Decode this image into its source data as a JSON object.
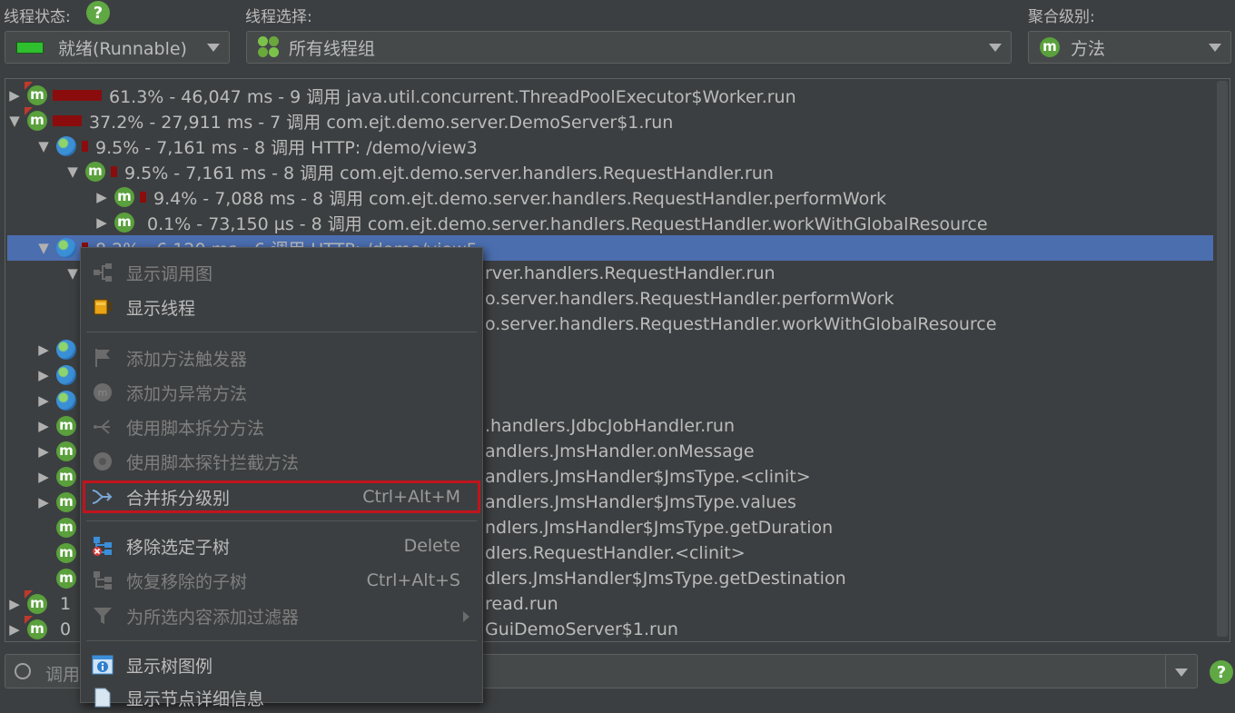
{
  "header": {
    "thread_state_label": "线程状态:",
    "thread_select_label": "线程选择:",
    "aggregation_label": "聚合级别:",
    "thread_state_value": "就绪(Runnable)",
    "thread_select_value": "所有线程组",
    "aggregation_value": "方法",
    "help_glyph": "?"
  },
  "icons": {
    "method_glyph": "m"
  },
  "tree": {
    "rows": [
      {
        "text": "61.3% - 46,047 ms - 9 调用 java.util.concurrent.ThreadPoolExecutor$Worker.run"
      },
      {
        "text": "37.2% - 27,911 ms - 7 调用 com.ejt.demo.server.DemoServer$1.run"
      },
      {
        "text": "9.5% - 7,161 ms - 8 调用 HTTP: /demo/view3"
      },
      {
        "text": "9.5% - 7,161 ms - 8 调用 com.ejt.demo.server.handlers.RequestHandler.run"
      },
      {
        "text": "9.4% - 7,088 ms - 8 调用 com.ejt.demo.server.handlers.RequestHandler.performWork"
      },
      {
        "text": "0.1% - 73,150 µs - 8 调用 com.ejt.demo.server.handlers.RequestHandler.workWithGlobalResource"
      },
      {
        "text": "8.2% - 6,120 ms - 6 调用 HTTP: /demo/view5"
      },
      {
        "text": "rver.handlers.RequestHandler.run"
      },
      {
        "text": "o.server.handlers.RequestHandler.performWork"
      },
      {
        "text": "o.server.handlers.RequestHandler.workWithGlobalResource"
      },
      {
        "text": ""
      },
      {
        "text": ""
      },
      {
        "text": ""
      },
      {
        "text": ".handlers.JdbcJobHandler.run"
      },
      {
        "text": "andlers.JmsHandler.onMessage"
      },
      {
        "text": "andlers.JmsHandler$JmsType.<clinit>"
      },
      {
        "text": "andlers.JmsHandler$JmsType.values"
      },
      {
        "text": "ndlers.JmsHandler$JmsType.getDuration"
      },
      {
        "text": "dlers.RequestHandler.<clinit>"
      },
      {
        "text": "dlers.JmsHandler$JmsType.getDestination"
      },
      {
        "text": "read.run"
      },
      {
        "text": "GuiDemoServer$1.run"
      }
    ],
    "partial_row_19_prefix": "1",
    "partial_row_20_prefix": "0"
  },
  "context_menu": {
    "items": [
      {
        "label": "显示调用图",
        "shortcut": "",
        "icon": "call-graph-icon",
        "enabled": false
      },
      {
        "label": "显示线程",
        "shortcut": "",
        "icon": "thread-cup-icon",
        "enabled": true
      },
      {
        "label": "添加方法触发器",
        "shortcut": "",
        "icon": "flag-icon",
        "enabled": false
      },
      {
        "label": "添加为异常方法",
        "shortcut": "",
        "icon": "exception-method-icon",
        "enabled": false
      },
      {
        "label": "使用脚本拆分方法",
        "shortcut": "",
        "icon": "split-icon",
        "enabled": false
      },
      {
        "label": "使用脚本探针拦截方法",
        "shortcut": "",
        "icon": "probe-icon",
        "enabled": false
      },
      {
        "label": "合并拆分级别",
        "shortcut": "Ctrl+Alt+M",
        "icon": "merge-icon",
        "enabled": true
      },
      {
        "label": "移除选定子树",
        "shortcut": "Delete",
        "icon": "remove-subtree-icon",
        "enabled": true
      },
      {
        "label": "恢复移除的子树",
        "shortcut": "Ctrl+Alt+S",
        "icon": "restore-subtree-icon",
        "enabled": false
      },
      {
        "label": "为所选内容添加过滤器",
        "shortcut": "",
        "icon": "filter-icon",
        "enabled": false
      },
      {
        "label": "显示树图例",
        "shortcut": "",
        "icon": "info-icon",
        "enabled": true
      },
      {
        "label": "显示节点详细信息",
        "shortcut": "",
        "icon": "document-icon",
        "enabled": true
      }
    ]
  },
  "search": {
    "placeholder": "调用"
  },
  "colors": {
    "background": "#3c3f41",
    "selection": "#4b6eaf",
    "bar": "#8b0c0c",
    "highlight_box": "#c0141c",
    "method_icon": "#5aa03c"
  }
}
